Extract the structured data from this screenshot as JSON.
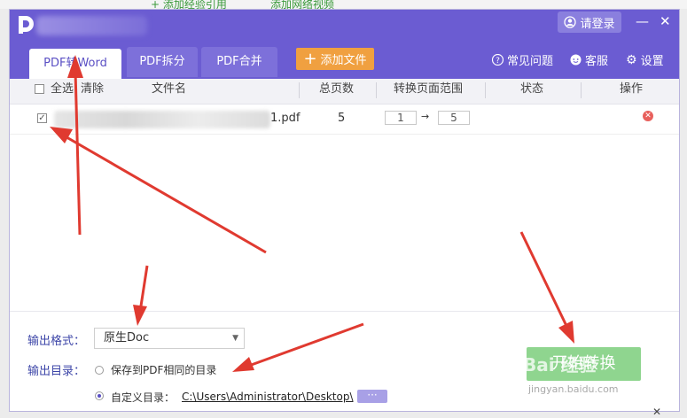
{
  "titlebar": {
    "login_label": "请登录",
    "controls": {
      "minimize": "—",
      "close": "✕"
    }
  },
  "tabs": [
    {
      "label": "PDF转Word",
      "active": true
    },
    {
      "label": "PDF拆分",
      "active": false
    },
    {
      "label": "PDF合并",
      "active": false
    }
  ],
  "add_file_button": "添加文件",
  "top_links": {
    "faq": "常见问题",
    "service": "客服",
    "settings": "设置"
  },
  "table": {
    "headers": {
      "select_all": "全选",
      "clear": "清除",
      "filename": "文件名",
      "total_pages": "总页数",
      "range": "转换页面范围",
      "status": "状态",
      "action": "操作"
    },
    "rows": [
      {
        "filename_suffix": "1.pdf",
        "pages": "5",
        "range_from": "1",
        "range_arrow": "→",
        "range_to": "5",
        "status": "",
        "checked": true
      }
    ]
  },
  "output": {
    "format_label": "输出格式：",
    "format_value": "原生Doc",
    "dir_label": "输出目录：",
    "option_same": "保存到PDF相同的目录",
    "option_custom": "自定义目录：",
    "custom_path": "C:\\Users\\Administrator\\Desktop\\",
    "browse_label": "···",
    "selected_option": "custom"
  },
  "start_button": "开始转换",
  "watermark": {
    "main": "Bai 经验",
    "sub": "jingyan.baidu.com"
  },
  "background": {
    "text1": "+ 添加经验引用",
    "text2": "添加网络视频"
  },
  "colors": {
    "brand": "#6b5cd2",
    "tab_inactive": "#7d70da",
    "add_button": "#f0a040",
    "start_button": "#8fd58f",
    "delete": "#e8605c",
    "annotation_arrow": "#e03a30"
  }
}
